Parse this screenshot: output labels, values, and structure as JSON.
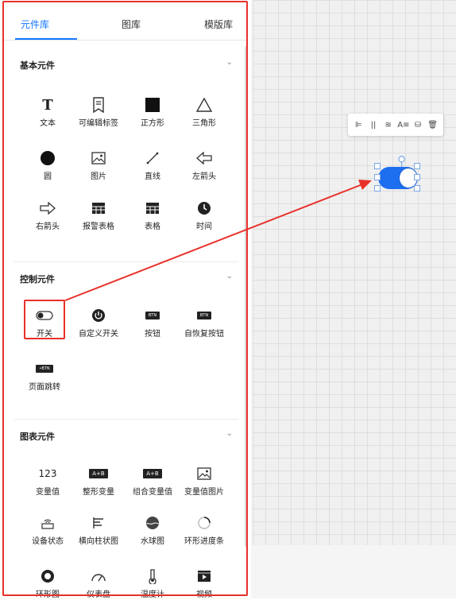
{
  "tabs": {
    "components": "元件库",
    "gallery": "图库",
    "templates": "模版库"
  },
  "sections": {
    "basic": {
      "title": "基本元件",
      "chevron": "⌄"
    },
    "control": {
      "title": "控制元件",
      "chevron": "⌄"
    },
    "chart": {
      "title": "图表元件",
      "chevron": "⌄"
    }
  },
  "basic_items": [
    "文本",
    "可编辑标签",
    "正方形",
    "三角形",
    "圆",
    "图片",
    "直线",
    "左箭头",
    "右箭头",
    "报警表格",
    "表格",
    "时间"
  ],
  "control_items": [
    "开关",
    "自定义开关",
    "按钮",
    "自恢复按钮",
    "页面跳转"
  ],
  "chart_items": [
    "变量值",
    "整形变量",
    "组合变量值",
    "变量值图片",
    "设备状态",
    "横向柱状图",
    "水球图",
    "环形进度条",
    "环形图",
    "仪表盘",
    "温度计",
    "视频"
  ],
  "icon_text": {
    "text_icon": "T",
    "value_icon": "123",
    "ab_icon": "A+B",
    "btn_icon": "BTN",
    "jump_icon": "•BTN",
    "gauge_icon": "◠"
  },
  "toolbar": {
    "align_left": "⊫",
    "align_center": "||",
    "layers": "≋",
    "font": "A≡",
    "style": "⛁",
    "delete": "🗑"
  },
  "colors": {
    "accent": "#1677ff",
    "highlight": "#e8312a",
    "switch_blue": "#1e6ef0"
  }
}
